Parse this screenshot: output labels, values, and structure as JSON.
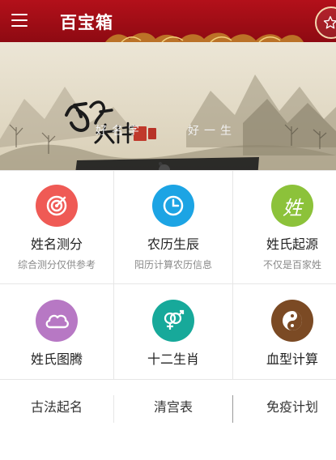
{
  "app": {
    "title": "百宝箱"
  },
  "banner": {
    "logo_text": "起名大师",
    "seal_text": "起名",
    "slogan_left": "好名字",
    "slogan_right": "好一生"
  },
  "grid": {
    "items": [
      {
        "label": "姓名测分",
        "sub": "综合测分仅供参考",
        "icon": "target-icon",
        "color": "#ef5a55"
      },
      {
        "label": "农历生辰",
        "sub": "阳历计算农历信息",
        "icon": "clock-icon",
        "color": "#1ca4e4"
      },
      {
        "label": "姓氏起源",
        "sub": "不仅是百家姓",
        "icon": "surname-icon",
        "icon_text": "姓",
        "color": "#8cc23a"
      },
      {
        "label": "姓氏图腾",
        "icon": "cloud-icon",
        "color": "#b778c4"
      },
      {
        "label": "十二生肖",
        "icon": "gender-icon",
        "color": "#17a99a"
      },
      {
        "label": "血型计算",
        "icon": "yin-yang-icon",
        "color": "#7b4a24"
      }
    ]
  },
  "bottom_links": [
    {
      "label": "古法起名"
    },
    {
      "label": "清宫表"
    },
    {
      "label": "免疫计划"
    }
  ]
}
